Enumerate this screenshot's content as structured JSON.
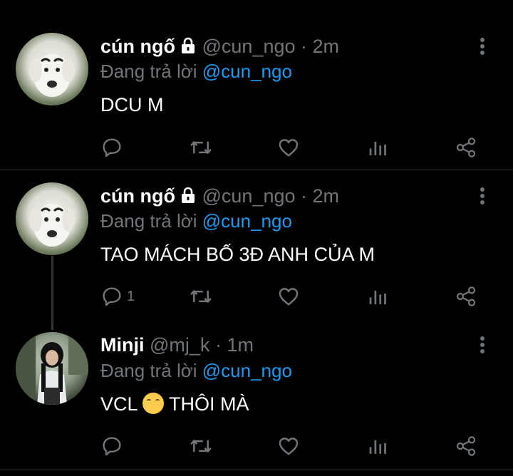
{
  "tweets": [
    {
      "name": "cún ngố",
      "handle": "@cun_ngo",
      "sep": " · ",
      "time": "2m",
      "reply_prefix": "Đang trả lời ",
      "reply_to": "@cun_ngo",
      "text": "DCU M",
      "reply_count": ""
    },
    {
      "name": "cún ngố",
      "handle": "@cun_ngo",
      "sep": " · ",
      "time": "2m",
      "reply_prefix": "Đang trả lời ",
      "reply_to": "@cun_ngo",
      "text": "TAO MÁCH BỐ 3Đ ANH CỦA M",
      "reply_count": "1"
    },
    {
      "name": "Minji",
      "handle": "@mj_k",
      "sep": " · ",
      "time": "1m",
      "reply_prefix": "Đang trả lời ",
      "reply_to": "@cun_ngo",
      "text_before": "VCL ",
      "text_after": " THÔI MÀ",
      "reply_count": ""
    }
  ],
  "colors": {
    "background": "#000000",
    "muted": "#71767b",
    "accent": "#1d9bf0",
    "text": "#ffffff"
  },
  "icons": [
    "lock-icon",
    "more-icon",
    "reply-icon",
    "retweet-icon",
    "like-icon",
    "views-icon",
    "share-icon",
    "crying-emoji"
  ]
}
